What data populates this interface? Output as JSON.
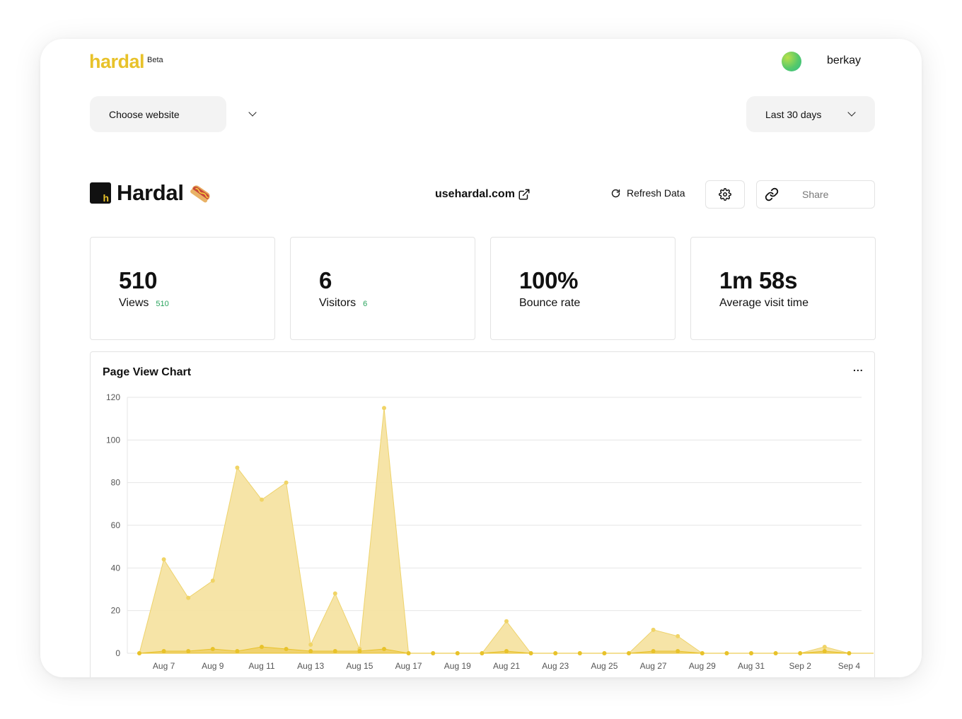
{
  "header": {
    "logo": "hardal",
    "beta": "Beta",
    "username": "berkay"
  },
  "filters": {
    "website_label": "Choose website",
    "range_label": "Last 30 days"
  },
  "site": {
    "name": "Hardal",
    "emoji_icon": "hotdog-icon",
    "domain": "usehardal.com",
    "refresh_label": "Refresh Data",
    "share_label": "Share"
  },
  "stats": [
    {
      "value": "510",
      "label": "Views",
      "delta": "510"
    },
    {
      "value": "6",
      "label": "Visitors",
      "delta": "6"
    },
    {
      "value": "100%",
      "label": "Bounce rate",
      "delta": ""
    },
    {
      "value": "1m 58s",
      "label": "Average visit time",
      "delta": ""
    }
  ],
  "chart": {
    "title": "Page View Chart",
    "menu": "..."
  },
  "colors": {
    "brand": "#e8c22a",
    "area_fill": "#f6e3a2",
    "area_line": "#eed36c",
    "delta_green": "#28a35c"
  },
  "chart_data": {
    "type": "area",
    "title": "Page View Chart",
    "x": [
      "Aug 6",
      "Aug 7",
      "Aug 8",
      "Aug 9",
      "Aug 10",
      "Aug 11",
      "Aug 12",
      "Aug 13",
      "Aug 14",
      "Aug 15",
      "Aug 16",
      "Aug 17",
      "Aug 18",
      "Aug 19",
      "Aug 20",
      "Aug 21",
      "Aug 22",
      "Aug 23",
      "Aug 24",
      "Aug 25",
      "Aug 26",
      "Aug 27",
      "Aug 28",
      "Aug 29",
      "Aug 30",
      "Aug 31",
      "Sep 1",
      "Sep 2",
      "Sep 3",
      "Sep 4",
      "Sep 5"
    ],
    "xticks": [
      "Aug 7",
      "Aug 9",
      "Aug 11",
      "Aug 13",
      "Aug 15",
      "Aug 17",
      "Aug 19",
      "Aug 21",
      "Aug 23",
      "Aug 25",
      "Aug 27",
      "Aug 29",
      "Aug 31",
      "Sep 2",
      "Sep 4"
    ],
    "series": [
      {
        "values": [
          0,
          44,
          26,
          34,
          87,
          72,
          80,
          4,
          28,
          2,
          115,
          0,
          0,
          0,
          0,
          15,
          0,
          0,
          0,
          0,
          0,
          11,
          8,
          0,
          0,
          0,
          0,
          0,
          3,
          0
        ]
      },
      {
        "values": [
          0,
          1,
          1,
          2,
          1,
          3,
          2,
          1,
          1,
          1,
          2,
          0,
          0,
          0,
          0,
          1,
          0,
          0,
          0,
          0,
          0,
          1,
          1,
          0,
          0,
          0,
          0,
          0,
          1,
          0
        ]
      }
    ],
    "ylim": [
      0,
      120
    ],
    "yticks": [
      0,
      20,
      40,
      60,
      80,
      100,
      120
    ],
    "grid": true
  }
}
